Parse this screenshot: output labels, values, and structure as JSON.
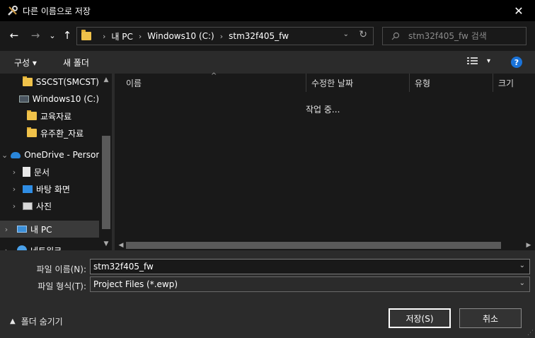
{
  "window": {
    "title": "다른 이름으로 저장",
    "close": "✕"
  },
  "nav": {
    "back": "←",
    "forward": "→",
    "recent": "⌄",
    "up": "↑",
    "breadcrumbs": [
      "내 PC",
      "Windows10 (C:)",
      "stm32f405_fw"
    ],
    "separator": "›",
    "dropdown": "⌄",
    "refresh": "↻",
    "search_placeholder": "stm32f405_fw 검색"
  },
  "toolbar": {
    "organize": "구성 ▾",
    "new_folder": "새 폴더",
    "view_dd": "▾",
    "help": "?"
  },
  "sidebar": {
    "items": [
      {
        "label": "SSCST(SMCST)",
        "icon": "folder-icon",
        "chevron": ""
      },
      {
        "label": "Windows10 (C:)",
        "icon": "drive-icon",
        "chevron": ""
      },
      {
        "label": "교육자료",
        "icon": "folder-icon",
        "chevron": ""
      },
      {
        "label": "유주환_자료",
        "icon": "folder-icon",
        "chevron": ""
      },
      {
        "label": "OneDrive - Persor",
        "icon": "cloud-icon",
        "chevron": "⌄"
      },
      {
        "label": "문서",
        "icon": "document-icon",
        "chevron": "›"
      },
      {
        "label": "바탕 화면",
        "icon": "desktop-icon",
        "chevron": "›"
      },
      {
        "label": "사진",
        "icon": "pictures-icon",
        "chevron": "›"
      },
      {
        "label": "내 PC",
        "icon": "pc-icon",
        "chevron": "›"
      },
      {
        "label": "네트워크",
        "icon": "network-icon",
        "chevron": "›"
      }
    ]
  },
  "files": {
    "columns": [
      "이름",
      "수정한 날짜",
      "유형",
      "크기"
    ],
    "sort_indicator": "^",
    "status": "작업 중..."
  },
  "form": {
    "filename_label": "파일 이름(N):",
    "filename_value": "stm32f405_fw",
    "filetype_label": "파일 형식(T):",
    "filetype_value": "Project Files (*.ewp)",
    "hide_folders": "폴더 숨기기",
    "save": "저장(S)",
    "cancel": "취소"
  },
  "colors": {
    "accent": "#1a73d9",
    "folder": "#f0c24a",
    "background": "#191919",
    "panel": "#2b2b2b"
  }
}
